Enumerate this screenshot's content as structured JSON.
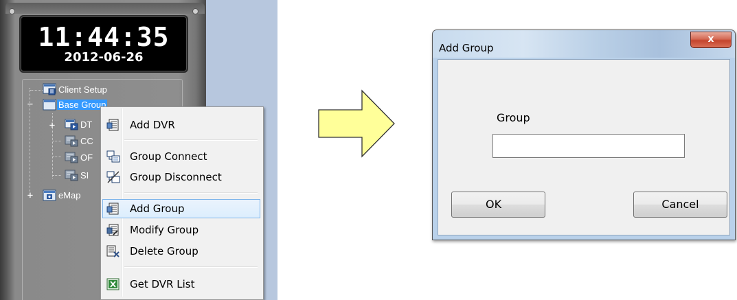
{
  "left_panel": {
    "clock_time": "11:44:35",
    "clock_date": "2012-06-26",
    "tree": [
      {
        "label": "Client Setup",
        "icon": "client-setup-icon"
      },
      {
        "label": "Base Group",
        "icon": "folder-icon",
        "selected": true,
        "expander": "−"
      },
      {
        "label": "DT",
        "icon": "dvr-group-icon",
        "expander": "+"
      },
      {
        "label": "CC",
        "icon": "dvr-icon"
      },
      {
        "label": "OF",
        "icon": "dvr-icon"
      },
      {
        "label": "SI",
        "icon": "dvr-icon"
      },
      {
        "label": "eMap",
        "icon": "emap-icon",
        "expander": "+"
      }
    ]
  },
  "context_menu": {
    "items": [
      {
        "label": "Add DVR",
        "icon": "add-dvr-icon"
      },
      {
        "label": "Group Connect",
        "icon": "group-connect-icon"
      },
      {
        "label": "Group Disconnect",
        "icon": "group-disconnect-icon"
      },
      {
        "label": "Add Group",
        "icon": "add-group-icon",
        "highlighted": true
      },
      {
        "label": "Modify Group",
        "icon": "modify-group-icon"
      },
      {
        "label": "Delete Group",
        "icon": "delete-group-icon"
      },
      {
        "label": "Get DVR List",
        "icon": "excel-icon"
      }
    ]
  },
  "arrow": {
    "icon": "right-arrow-icon",
    "fill": "#ffff99",
    "stroke": "#333333"
  },
  "dialog": {
    "title": "Add Group",
    "close_label": "x",
    "group_label": "Group",
    "group_value": "",
    "ok_label": "OK",
    "cancel_label": "Cancel"
  },
  "colors": {
    "selection": "#3399ff",
    "menu_highlight_border": "#7eb4ea",
    "close_button": "#c4442d",
    "dialog_frame": "#b9d1ea"
  }
}
